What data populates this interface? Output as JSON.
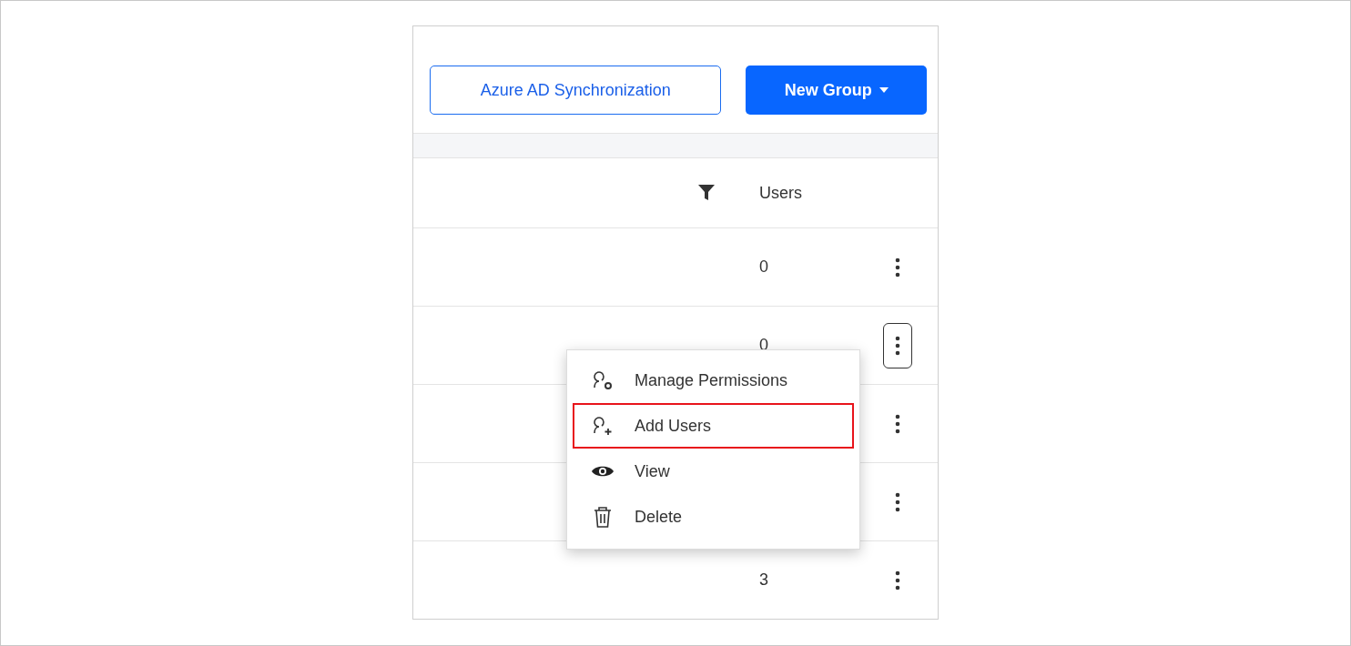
{
  "toolbar": {
    "buttons": [
      {
        "label": "Azure AD Synchronization",
        "kind": "outline"
      },
      {
        "label": "New Group",
        "kind": "dropdown"
      }
    ]
  },
  "table": {
    "columns": [
      {
        "label": "Users",
        "filter": true
      }
    ],
    "rows": [
      {
        "users": "0",
        "menu_open": false
      },
      {
        "users": "0",
        "menu_open": true
      },
      {
        "menu_open": false
      },
      {
        "menu_open": false
      },
      {
        "users": "3",
        "menu_open": false
      }
    ]
  },
  "context_menu": {
    "items": [
      {
        "label": "Manage Permissions",
        "kind": "permissions",
        "highlighted": false
      },
      {
        "label": "Add Users",
        "kind": "add-user",
        "highlighted": true
      },
      {
        "label": "View",
        "kind": "view",
        "highlighted": false
      },
      {
        "label": "Delete",
        "kind": "delete",
        "highlighted": false
      }
    ]
  }
}
